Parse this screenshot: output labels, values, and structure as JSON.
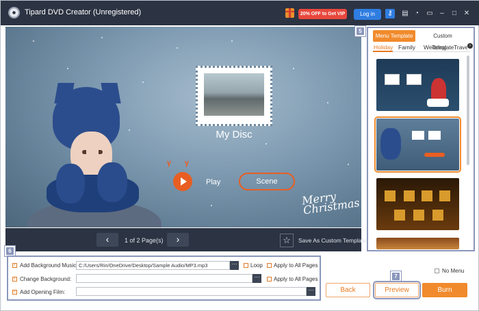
{
  "window": {
    "title": "Tipard DVD Creator (Unregistered)",
    "promo": "20% OFF to Get VIP",
    "login": "Log in"
  },
  "preview": {
    "disc_title": "My Disc",
    "play_label": "Play",
    "scene_label": "Scene",
    "greeting": "Merry Christmas"
  },
  "pager": {
    "page_info": "1 of 2 Page(s)",
    "save_template": "Save As Custom Template"
  },
  "panel": {
    "badge": "5",
    "tabs": [
      "Menu Template",
      "Custom Template"
    ],
    "categories": [
      "Holiday",
      "Family",
      "Wedding",
      "Travel"
    ]
  },
  "options": {
    "badge": "6",
    "background_music": {
      "label": "Add Background Music:",
      "value": "C:/Users/Rin/OneDrive/Desktop/Sample Audio/MP3.mp3",
      "checked": true
    },
    "loop": {
      "label": "Loop",
      "checked": false
    },
    "apply_all_1": {
      "label": "Apply to All Pages",
      "checked": false
    },
    "change_background": {
      "label": "Change Background:",
      "value": "",
      "checked": true
    },
    "apply_all_2": {
      "label": "Apply to All Pages",
      "checked": false
    },
    "opening_film": {
      "label": "Add Opening Film:",
      "value": "",
      "checked": true
    }
  },
  "footer": {
    "no_menu": "No Menu",
    "back": "Back",
    "preview": "Preview",
    "preview_badge": "7",
    "burn": "Burn"
  },
  "colors": {
    "accent": "#f18a2c",
    "titlebar": "#2c3443",
    "highlight": "#8a97bb",
    "login": "#2f7de1"
  }
}
